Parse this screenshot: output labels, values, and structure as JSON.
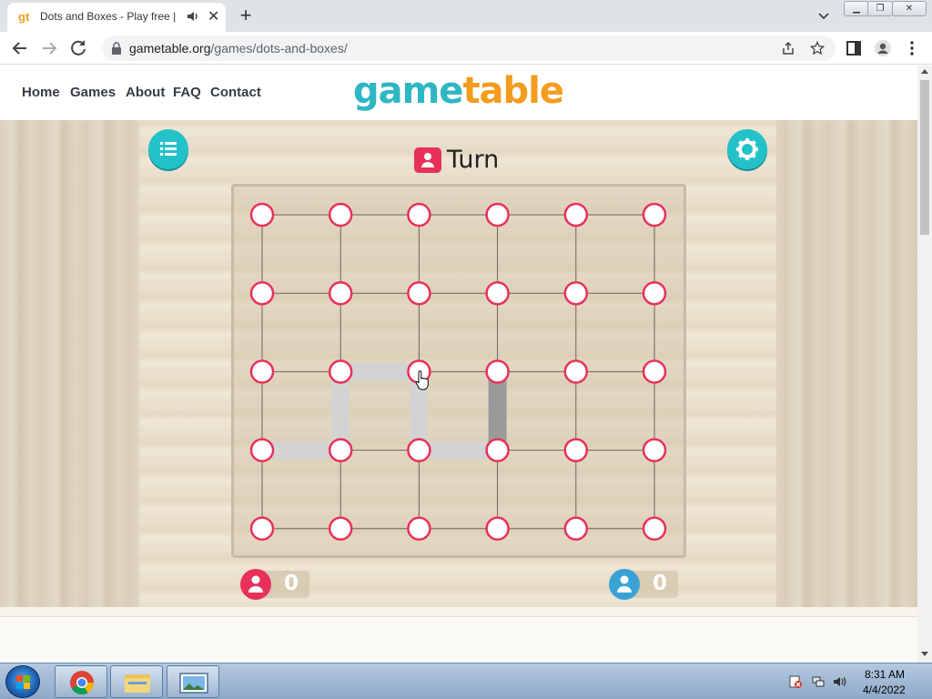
{
  "browser": {
    "tab_favicon": "gt",
    "tab_title": "Dots and Boxes - Play free | G",
    "new_tab": "+",
    "close": "✕",
    "url_domain": "gametable.org",
    "url_path": "/games/dots-and-boxes/",
    "icons": [
      "back-arrow-icon",
      "forward-arrow-icon",
      "reload-icon",
      "lock-icon",
      "share-icon",
      "star-icon",
      "side-panel-icon",
      "profile-icon",
      "menu-dots-icon",
      "audio-icon",
      "chevron-down-icon"
    ]
  },
  "site": {
    "nav": [
      "Home",
      "Games",
      "About",
      "FAQ",
      "Contact"
    ],
    "logo_part1": "game",
    "logo_part2": "table",
    "brand_teal": "#2fb6c3",
    "brand_orange": "#f39c1e"
  },
  "game": {
    "turn_label": "Turn",
    "turn_color": "#e8315a",
    "grid": {
      "rows": 5,
      "cols": 6
    },
    "drawn_lines": [
      {
        "from": [
          2,
          1
        ],
        "to": [
          2,
          2
        ],
        "style": "light"
      },
      {
        "from": [
          2,
          1
        ],
        "to": [
          3,
          1
        ],
        "style": "light"
      },
      {
        "from": [
          2,
          2
        ],
        "to": [
          3,
          2
        ],
        "style": "light"
      },
      {
        "from": [
          3,
          0
        ],
        "to": [
          3,
          1
        ],
        "style": "light"
      },
      {
        "from": [
          3,
          2
        ],
        "to": [
          3,
          3
        ],
        "style": "light"
      },
      {
        "from": [
          2,
          3
        ],
        "to": [
          3,
          3
        ],
        "style": "dark"
      }
    ],
    "player1_score": "0",
    "player2_score": "0",
    "player1_color": "#e8315a",
    "player2_color": "#3aa2d4",
    "menu_icon": "list-icon",
    "settings_icon": "gear-icon"
  },
  "taskbar": {
    "time": "8:31 AM",
    "date": "4/4/2022",
    "apps": [
      "chrome-icon",
      "file-explorer-icon",
      "image-viewer-icon"
    ]
  }
}
